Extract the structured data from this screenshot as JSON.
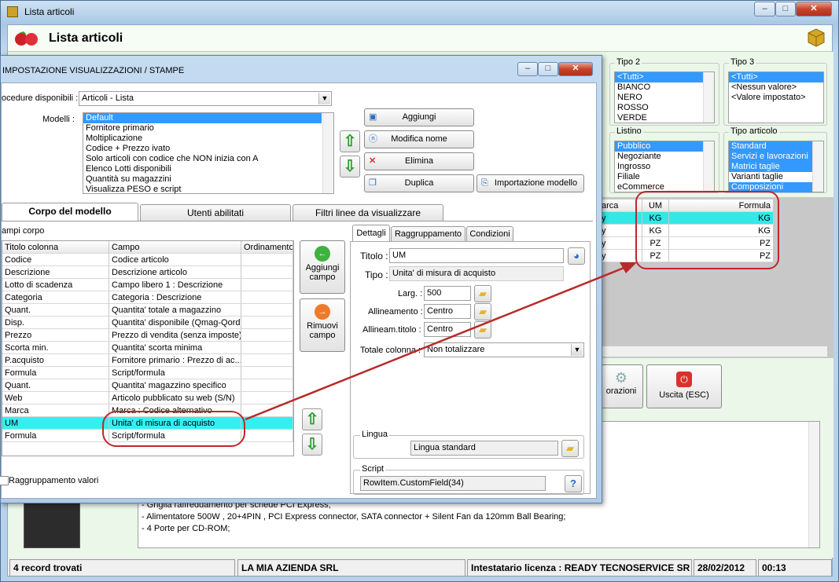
{
  "window": {
    "title": "Lista articoli",
    "header": "Lista articoli",
    "min": "–",
    "max": "□",
    "close": "✕"
  },
  "bg_filters": {
    "tipo2": {
      "label": "Tipo 2",
      "items": [
        "<Tutti>",
        "BIANCO",
        "NERO",
        "ROSSO",
        "VERDE"
      ]
    },
    "tipo3": {
      "label": "Tipo 3",
      "items": [
        "<Tutti>",
        "<Nessun valore>",
        "<Valore impostato>"
      ]
    },
    "listino": {
      "label": "Listino",
      "items": [
        "Pubblico",
        "Negoziante",
        "Ingrosso",
        "Filiale",
        "eCommerce"
      ]
    },
    "tipo_articolo": {
      "label": "Tipo articolo",
      "items": [
        "Standard",
        "Servizi e lavorazioni",
        "Matrici taglie",
        "Varianti taglie",
        "Composizioni"
      ]
    }
  },
  "bg_grid": {
    "headers": [
      "arca",
      "UM",
      "Formula"
    ],
    "rows": [
      [
        "y",
        "KG",
        "KG"
      ],
      [
        "y",
        "KG",
        "KG"
      ],
      [
        "y",
        "PZ",
        "PZ"
      ],
      [
        "y",
        "PZ",
        "PZ"
      ]
    ]
  },
  "bg_buttons": {
    "lavorazioni": "orazioni",
    "uscita": "Uscita (ESC)"
  },
  "bg_desc": [
    "- Griglia raffreddamento per schede PCI Express;",
    "- Alimentatore 500W , 20+4PIN , PCI Express connector, SATA connector + Silent Fan da 120mm Ball Bearing;",
    "- 4 Porte per CD-ROM;"
  ],
  "status": {
    "records": "4 record trovati",
    "company": "LA MIA AZIENDA SRL",
    "license": "Intestatario licenza : READY TECNOSERVICE SR",
    "date": "28/02/2012",
    "time": "00:13"
  },
  "dialog": {
    "title": "IMPOSTAZIONE VISUALIZZAZIONI / STAMPE",
    "procedure_label": "ocedure disponibili :",
    "procedure_value": "Articoli - Lista",
    "models_label": "Modelli :",
    "models": [
      "Default",
      "Fornitore primario",
      "Moltiplicazione",
      "Codice + Prezzo ivato",
      "Solo articoli con codice che NON inizia con A",
      "Elenco Lotti disponibili",
      "Quantità su magazzini",
      "Visualizza PESO e script"
    ],
    "btn_add": "Aggiungi",
    "btn_rename": "Modifica nome",
    "btn_delete": "Elimina",
    "btn_duplicate": "Duplica",
    "btn_import": "Importazione modello",
    "tabs": [
      "Corpo del modello",
      "Utenti abilitati",
      "Filtri linee da visualizzare"
    ],
    "campi_label": "ampi corpo",
    "grid_headers": [
      "Titolo colonna",
      "Campo",
      "Ordinamento"
    ],
    "grid_rows": [
      [
        "Codice",
        "Codice articolo"
      ],
      [
        "Descrizione",
        "Descrizione articolo"
      ],
      [
        "Lotto di scadenza",
        "Campo libero 1 : Descrizione"
      ],
      [
        "Categoria",
        "Categoria : Descrizione"
      ],
      [
        "Quant.",
        "Quantita' totale a magazzino"
      ],
      [
        "Disp.",
        "Quantita' disponibile (Qmag-Qord)"
      ],
      [
        "Prezzo",
        "Prezzo di vendita (senza imposte)"
      ],
      [
        "Scorta min.",
        "Quantita' scorta minima"
      ],
      [
        "P.acquisto",
        "Fornitore primario : Prezzo di ac..."
      ],
      [
        "Formula",
        "Script/formula"
      ],
      [
        "Quant.",
        "Quantita' magazzino specifico"
      ],
      [
        "Web",
        "Articolo pubblicato su web (S/N)"
      ],
      [
        "Marca",
        "Marca : Codice alternativo"
      ],
      [
        "UM",
        "Unita' di misura di acquisto"
      ],
      [
        "Formula",
        "Script/formula"
      ]
    ],
    "btn_add_field": "Aggiungi campo",
    "btn_remove_field": "Rimuovi campo",
    "grouping_label": "Raggruppamento valori",
    "detail_tabs": [
      "Dettagli",
      "Raggruppamento",
      "Condizioni"
    ],
    "titolo_label": "Titolo :",
    "titolo_value": "UM",
    "tipo_label": "Tipo :",
    "tipo_value": "Unita' di misura di acquisto",
    "larg_label": "Larg. :",
    "larg_value": "500",
    "allin_label": "Allineamento :",
    "allin_value": "Centro",
    "allint_label": "Allineam.titolo :",
    "allint_value": "Centro",
    "totale_label": "Totale colonna :",
    "totale_value": "Non totalizzare",
    "lingua_label": "Lingua",
    "lingua_value": "Lingua standard",
    "script_label": "Script",
    "script_value": "RowItem.CustomField(34)"
  }
}
